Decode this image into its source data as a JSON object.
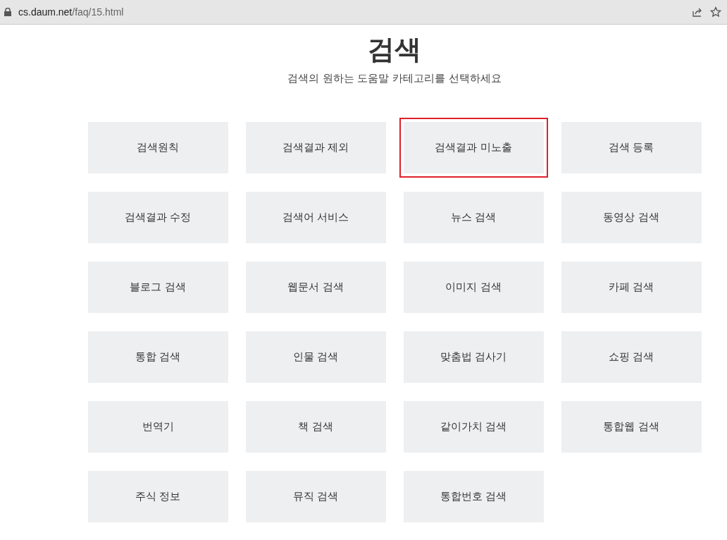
{
  "browser": {
    "url_host": "cs.daum.net",
    "url_path": "/faq/15.html"
  },
  "header": {
    "title": "검색",
    "subtitle": "검색의 원하는 도움말 카테고리를 선택하세요"
  },
  "categories": [
    {
      "label": "검색원칙",
      "selected": false
    },
    {
      "label": "검색결과 제외",
      "selected": false
    },
    {
      "label": "검색결과 미노출",
      "selected": true
    },
    {
      "label": "검색 등록",
      "selected": false
    },
    {
      "label": "검색결과 수정",
      "selected": false
    },
    {
      "label": "검색어 서비스",
      "selected": false
    },
    {
      "label": "뉴스 검색",
      "selected": false
    },
    {
      "label": "동영상 검색",
      "selected": false
    },
    {
      "label": "블로그 검색",
      "selected": false
    },
    {
      "label": "웹문서 검색",
      "selected": false
    },
    {
      "label": "이미지 검색",
      "selected": false
    },
    {
      "label": "카페 검색",
      "selected": false
    },
    {
      "label": "통합 검색",
      "selected": false
    },
    {
      "label": "인물 검색",
      "selected": false
    },
    {
      "label": "맞춤법 검사기",
      "selected": false
    },
    {
      "label": "쇼핑 검색",
      "selected": false
    },
    {
      "label": "번역기",
      "selected": false
    },
    {
      "label": "책 검색",
      "selected": false
    },
    {
      "label": "같이가치 검색",
      "selected": false
    },
    {
      "label": "통합웹 검색",
      "selected": false
    },
    {
      "label": "주식 정보",
      "selected": false
    },
    {
      "label": "뮤직 검색",
      "selected": false
    },
    {
      "label": "통합번호 검색",
      "selected": false
    }
  ]
}
